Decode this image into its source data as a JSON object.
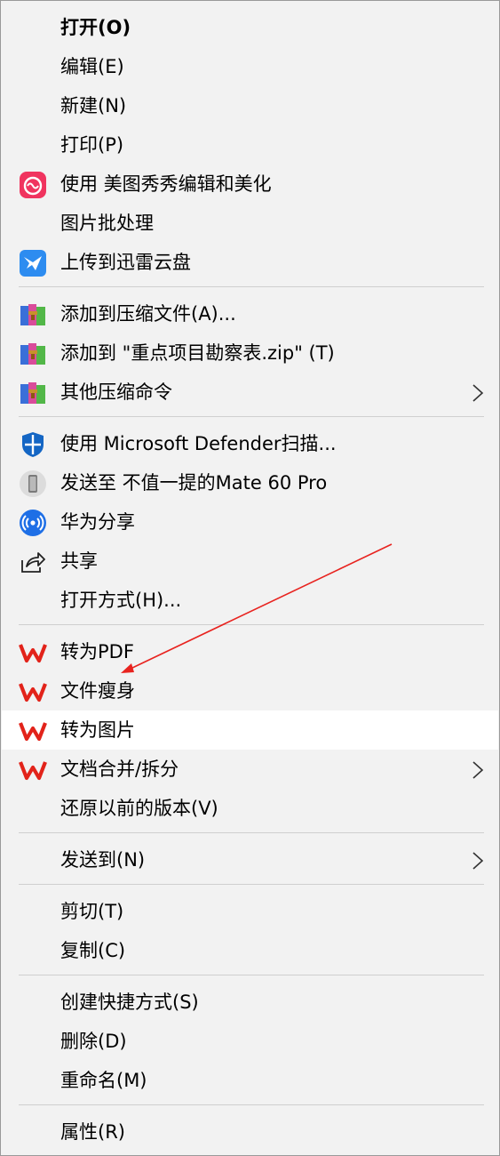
{
  "menu": {
    "items": [
      {
        "label": "打开(O)",
        "icon": "",
        "bold": true
      },
      {
        "label": "编辑(E)",
        "icon": ""
      },
      {
        "label": "新建(N)",
        "icon": ""
      },
      {
        "label": "打印(P)",
        "icon": ""
      },
      {
        "label": "使用 美图秀秀编辑和美化",
        "icon": "meitu-icon"
      },
      {
        "label": "图片批处理",
        "icon": ""
      },
      {
        "label": "上传到迅雷云盘",
        "icon": "xunlei-icon"
      },
      {
        "label": "添加到压缩文件(A)...",
        "icon": "winrar-icon"
      },
      {
        "label": "添加到 \"重点项目勘察表.zip\" (T)",
        "icon": "winrar-icon"
      },
      {
        "label": "其他压缩命令",
        "icon": "winrar-icon",
        "submenu": true
      },
      {
        "label": "使用 Microsoft Defender扫描...",
        "icon": "defender-icon"
      },
      {
        "label": "发送至 不值一提的Mate 60 Pro",
        "icon": "phone-icon"
      },
      {
        "label": "华为分享",
        "icon": "huawei-share-icon"
      },
      {
        "label": "共享",
        "icon": "share-icon"
      },
      {
        "label": "打开方式(H)...",
        "icon": ""
      },
      {
        "label": "转为PDF",
        "icon": "wps-icon"
      },
      {
        "label": "文件瘦身",
        "icon": "wps-icon"
      },
      {
        "label": "转为图片",
        "icon": "wps-icon",
        "highlighted": true
      },
      {
        "label": "文档合并/拆分",
        "icon": "wps-icon",
        "submenu": true
      },
      {
        "label": "还原以前的版本(V)",
        "icon": ""
      },
      {
        "label": "发送到(N)",
        "icon": "",
        "submenu": true
      },
      {
        "label": "剪切(T)",
        "icon": ""
      },
      {
        "label": "复制(C)",
        "icon": ""
      },
      {
        "label": "创建快捷方式(S)",
        "icon": ""
      },
      {
        "label": "删除(D)",
        "icon": ""
      },
      {
        "label": "重命名(M)",
        "icon": ""
      },
      {
        "label": "属性(R)",
        "icon": ""
      }
    ]
  },
  "colors": {
    "menu_background": "#f2f2f2",
    "highlight_background": "#ffffff",
    "separator": "#cfcfcf",
    "annotation_arrow": "#e8231f",
    "wps_red": "#e2231a",
    "xunlei_blue": "#2d8cf0",
    "meitu_pink": "#f0345f"
  }
}
